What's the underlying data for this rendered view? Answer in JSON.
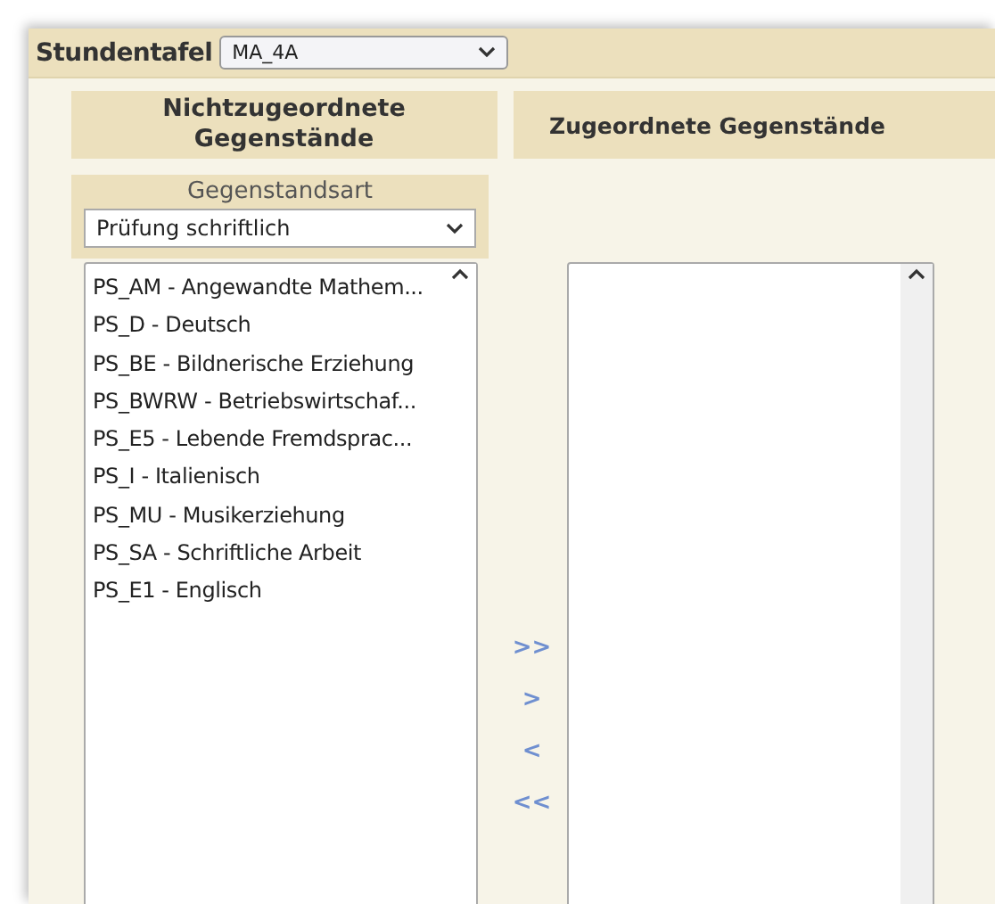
{
  "header": {
    "label": "Stundentafel",
    "select_value": "MA_4A"
  },
  "left": {
    "title": "Nichtzugeordnete Gegenstände",
    "filter_label": "Gegenstandsart",
    "filter_value": "Prüfung schriftlich",
    "items": [
      {
        "text": "PS_AM - Angewandte Mathem..."
      },
      {
        "text": "PS_D - Deutsch"
      },
      {
        "text": "PS_BE - Bildnerische Erziehung"
      },
      {
        "text": "PS_BWRW - Betriebswirtschaf..."
      },
      {
        "text": "PS_E5 - Lebende Fremdsprac..."
      },
      {
        "text": "PS_I - Italienisch"
      },
      {
        "text": "PS_MU - Musikerziehung"
      },
      {
        "text": "PS_SA - Schriftliche Arbeit"
      },
      {
        "text": "PS_E1 - Englisch"
      }
    ]
  },
  "move_buttons": [
    ">>",
    ">",
    "<",
    "<<"
  ],
  "right": {
    "title": "Zugeordnete Gegenstände"
  }
}
